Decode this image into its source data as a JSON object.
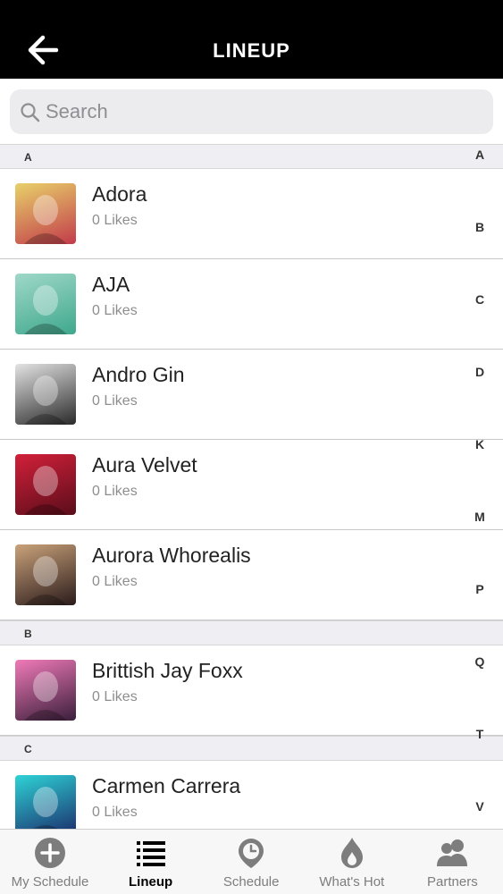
{
  "header": {
    "title": "LINEUP"
  },
  "search": {
    "placeholder": "Search"
  },
  "sections": [
    {
      "letter": "A",
      "items": [
        {
          "name": "Adora",
          "likes": "0 Likes",
          "colors": [
            "#e8d16a",
            "#c23b4a"
          ]
        },
        {
          "name": "AJA",
          "likes": "0 Likes",
          "colors": [
            "#9fd8c8",
            "#3fa88d"
          ]
        },
        {
          "name": "Andro Gin",
          "likes": "0 Likes",
          "colors": [
            "#e3e3e3",
            "#2a2a2a"
          ]
        },
        {
          "name": "Aura Velvet",
          "likes": "0 Likes",
          "colors": [
            "#d2203a",
            "#5a0d1a"
          ]
        },
        {
          "name": "Aurora Whorealis",
          "likes": "0 Likes",
          "colors": [
            "#c9a27a",
            "#2b1b1b"
          ]
        }
      ]
    },
    {
      "letter": "B",
      "items": [
        {
          "name": "Brittish Jay Foxx",
          "likes": "0 Likes",
          "colors": [
            "#f07ab8",
            "#3a1f3b"
          ]
        }
      ]
    },
    {
      "letter": "C",
      "items": [
        {
          "name": "Carmen Carrera",
          "likes": "0 Likes",
          "colors": [
            "#2ed3d6",
            "#1b2b6b"
          ]
        }
      ]
    }
  ],
  "index_letters": [
    "A",
    "B",
    "C",
    "D",
    "K",
    "M",
    "P",
    "Q",
    "T",
    "V"
  ],
  "tabs": [
    {
      "label": "My Schedule",
      "icon": "plus-circle-icon",
      "active": false
    },
    {
      "label": "Lineup",
      "icon": "list-icon",
      "active": true
    },
    {
      "label": "Schedule",
      "icon": "clock-pin-icon",
      "active": false
    },
    {
      "label": "What's Hot",
      "icon": "flame-icon",
      "active": false
    },
    {
      "label": "Partners",
      "icon": "users-icon",
      "active": false
    }
  ]
}
